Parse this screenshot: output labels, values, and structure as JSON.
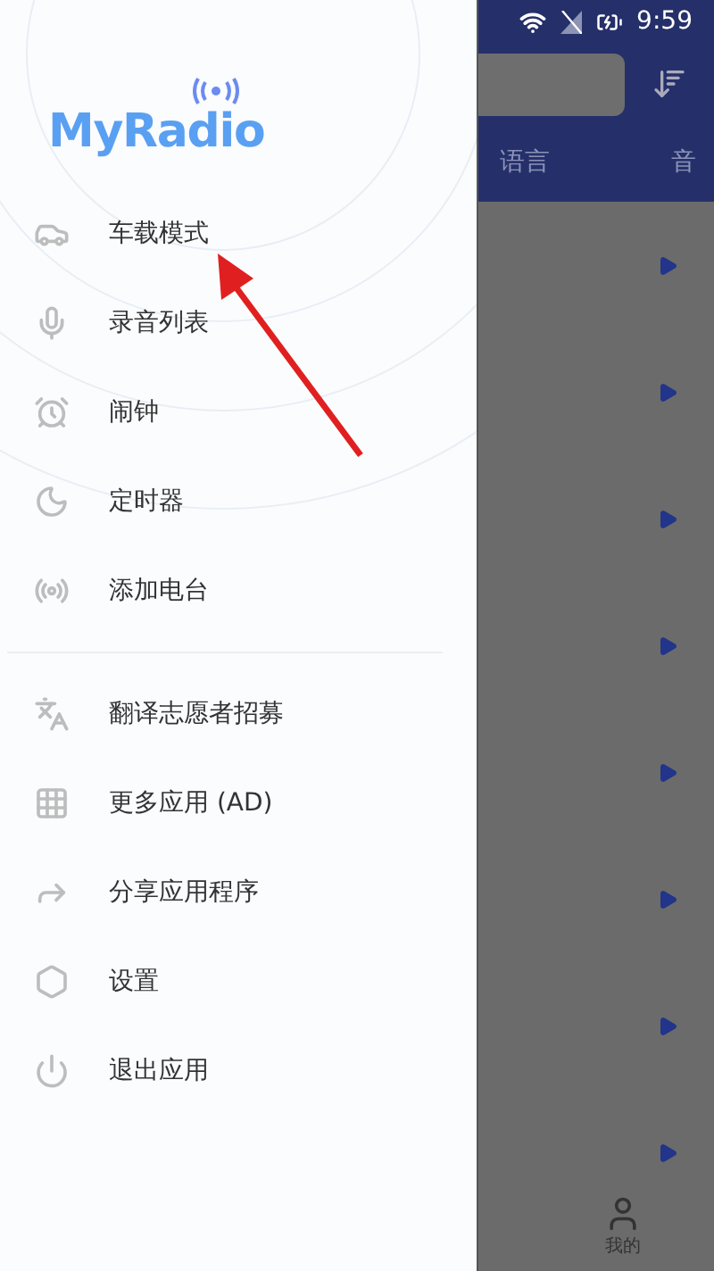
{
  "status_bar": {
    "time": "9:59"
  },
  "drawer": {
    "logo": "MyRadio",
    "menu": [
      {
        "label": "车载模式"
      },
      {
        "label": "录音列表"
      },
      {
        "label": "闹钟"
      },
      {
        "label": "定时器"
      },
      {
        "label": "添加电台"
      }
    ],
    "more": [
      {
        "label": "翻译志愿者招募"
      },
      {
        "label": "更多应用 (AD)"
      },
      {
        "label": "分享应用程序"
      },
      {
        "label": "设置"
      },
      {
        "label": "退出应用"
      }
    ]
  },
  "background_app": {
    "tabs": [
      {
        "label": "语言"
      },
      {
        "label": "音"
      }
    ],
    "bottom_nav": [
      {
        "label": "我的"
      }
    ]
  }
}
